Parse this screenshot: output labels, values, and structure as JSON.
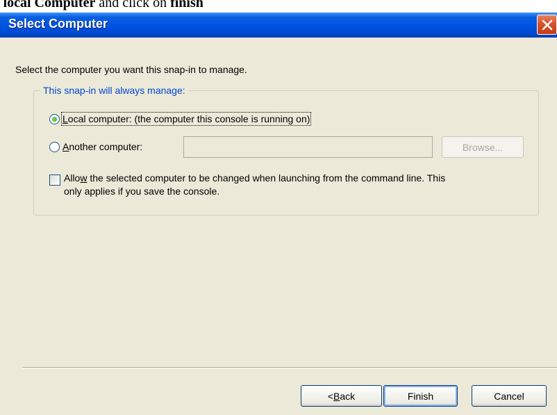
{
  "caption": {
    "prefix": "t ",
    "bold1": "local Computer",
    "middle": " and click on ",
    "bold2": "finish"
  },
  "window": {
    "title": "Select Computer",
    "close_icon": "close-x-icon"
  },
  "instruction": "Select the computer you want this snap-in to manage.",
  "group": {
    "legend": "This snap-in will always manage:",
    "local": {
      "mnemonic": "L",
      "rest": "ocal computer:  (the computer this console is running on)",
      "selected": true
    },
    "another": {
      "mnemonic": "A",
      "rest": "nother computer:",
      "selected": false,
      "value": ""
    },
    "browse_label": "Browse...",
    "allow": {
      "pre": "Allo",
      "mnemonic": "w",
      "rest": " the selected computer to be changed when launching from the command line.  This",
      "line2": "only applies if you save the console.",
      "checked": false
    }
  },
  "buttons": {
    "back_prefix": "< ",
    "back_mnemonic": "B",
    "back_rest": "ack",
    "finish": "Finish",
    "cancel": "Cancel"
  },
  "colors": {
    "titlebar": "#0054e3",
    "dialog_bg": "#ece9d8",
    "legend": "#0046d5",
    "radio_dot": "#21a121",
    "close_button": "#d9532a"
  }
}
